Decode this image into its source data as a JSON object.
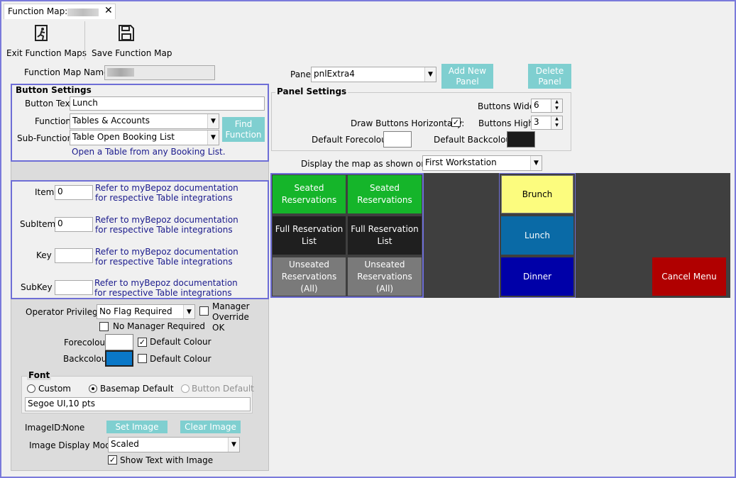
{
  "tab": {
    "title": "Function Map:",
    "close": "✕"
  },
  "toolbar": {
    "exit_label": "Exit Function Maps",
    "save_label": "Save Function Map"
  },
  "function_map_name": {
    "label": "Function Map Name:",
    "value": ""
  },
  "button_settings": {
    "title": "Button Settings",
    "button_text_label": "Button Text",
    "button_text_value": "Lunch",
    "function_label": "Function",
    "function_value": "Tables & Accounts",
    "sub_function_label": "Sub-Function",
    "sub_function_value": "Table Open Booking List",
    "find_function_label": "Find Function",
    "description": "Open a Table from any Booking List."
  },
  "params": {
    "doc_note": "Refer to myBepoz documentation for respective Table integrations",
    "item_label": "Item",
    "item_value": "0",
    "subitem_label": "SubItem",
    "subitem_value": "0",
    "key_label": "Key",
    "key_value": "",
    "subkey_label": "SubKey",
    "subkey_value": ""
  },
  "privilege": {
    "operator_label": "Operator Privilege:",
    "operator_value": "No Flag Required",
    "manager_override_label": "Manager Override OK",
    "manager_override_checked": false,
    "no_manager_label": "No Manager Required",
    "no_manager_checked": false
  },
  "colours": {
    "fore_label": "Forecolour",
    "fore_color": "#ffffff",
    "fore_default_label": "Default Colour",
    "fore_default_checked": true,
    "back_label": "Backcolour",
    "back_color": "#0a78c8",
    "back_default_label": "Default Colour",
    "back_default_checked": false
  },
  "font": {
    "title": "Font",
    "custom_label": "Custom",
    "basemap_label": "Basemap Default",
    "button_default_label": "Button Default",
    "selected": "basemap",
    "value": "Segoe UI,10 pts"
  },
  "image": {
    "id_label": "ImageID:",
    "id_value": "None",
    "set_label": "Set Image",
    "clear_label": "Clear Image",
    "mode_label": "Image Display Mode:",
    "mode_value": "Scaled",
    "show_text_label": "Show Text with Image",
    "show_text_checked": true
  },
  "panel": {
    "label": "Panel",
    "value": "pnlExtra4",
    "add_label": "Add New Panel",
    "delete_label": "Delete Panel"
  },
  "panel_settings": {
    "title": "Panel Settings",
    "buttons_wide_label": "Buttons Wide:",
    "buttons_wide_value": "6",
    "draw_horizontal_label": "Draw Buttons Horizontally:",
    "draw_horizontal_checked": true,
    "buttons_high_label": "Buttons High:",
    "buttons_high_value": "3",
    "default_fore_label": "Default Forecolour",
    "default_fore_color": "#ffffff",
    "default_back_label": "Default Backcolour",
    "default_back_color": "#1a1a1a"
  },
  "display_till": {
    "label": "Display the map as shown on till:",
    "value": "First Workstation"
  },
  "map_buttons": {
    "seated_1": "Seated Reservations",
    "seated_2": "Seated Reservations",
    "full_1": "Full Reservation List",
    "full_2": "Full Reservation List",
    "unseated_1": "Unseated Reservations (All)",
    "unseated_2": "Unseated Reservations (All)",
    "brunch": "Brunch",
    "lunch": "Lunch",
    "dinner": "Dinner",
    "cancel": "Cancel Menu"
  },
  "colors": {
    "accent_border": "#6e6ed6",
    "teal_button": "#7fcfd0",
    "map_background": "#3f3f3f",
    "green": "#15b52a",
    "black": "#1f1f1f",
    "gray": "#7a7a7a",
    "yellow": "#fcfc7e",
    "blue_lunch": "#0a6aa6",
    "navy": "#0000a8",
    "red": "#b00000"
  }
}
